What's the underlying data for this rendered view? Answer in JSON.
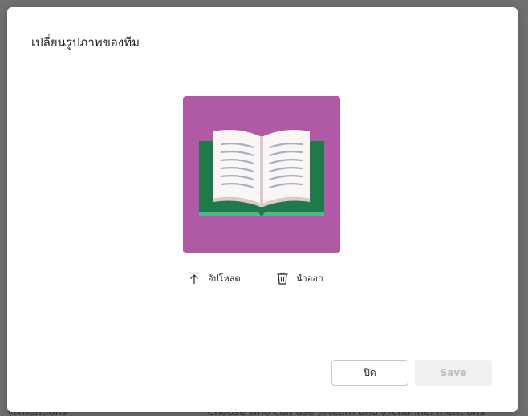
{
  "background": {
    "left_text": "@mentions",
    "right_text": "Choose who can use @team and @channel mentions"
  },
  "dialog": {
    "title": "เปลี่ยนรูปภาพของทีม",
    "picture": {
      "icon": "book-icon",
      "background_color": "#b05aa6"
    },
    "actions": {
      "upload_label": "อัปโหลด",
      "remove_label": "นำออก"
    },
    "buttons": {
      "close_label": "ปิด",
      "save_label": "Save"
    }
  }
}
